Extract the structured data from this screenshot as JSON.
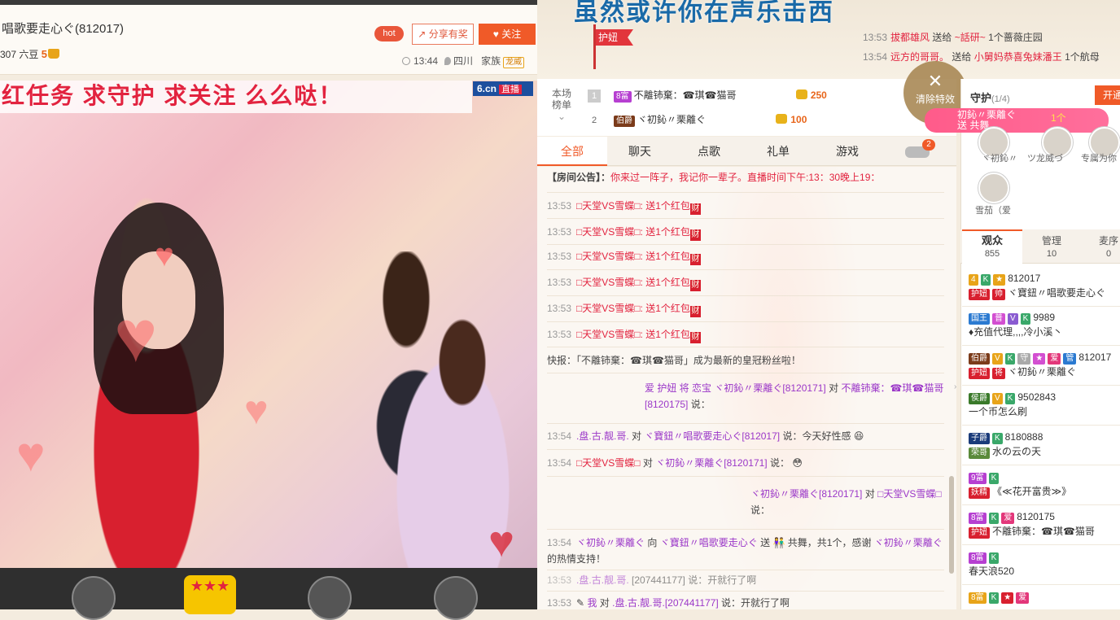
{
  "header": {
    "title": "唱歌要走心ぐ(812017)",
    "sub_prefix": "307 六豆",
    "level": "5",
    "hot": "hot",
    "share": "分享有奖",
    "follow": "关注",
    "time": "13:44",
    "location": "四川",
    "family_label": "家族",
    "family_badge": "龙威"
  },
  "video": {
    "banner": "红任务   求守护   求关注   么么哒！",
    "logo": "6.cn",
    "live": "直播",
    "gift_icon": "★★★"
  },
  "top_area": {
    "big_text": "虽然或许你在声乐击西",
    "guard_flag": "护妞",
    "messages": [
      {
        "time": "13:53",
        "from": "拔都雄风",
        "verb": "送给",
        "to": "~話研~",
        "gift": "1个蔷薇庄园"
      },
      {
        "time": "13:54",
        "from": "远方的哥哥。",
        "verb": "送给",
        "to": "小舅妈恭喜兔妹潘王",
        "gift": "1个航母"
      }
    ]
  },
  "ranking": {
    "label_line1": "本场",
    "label_line2": "榜单",
    "rows": [
      {
        "rank": "1",
        "badge": "8富",
        "name": "不離铈棄：☎琪☎猫哥",
        "score": "250"
      },
      {
        "rank": "2",
        "badge": "伯爵",
        "name": "ヾ初鈊〃栗離ぐ",
        "score": "100"
      }
    ]
  },
  "tabs": [
    "全部",
    "聊天",
    "点歌",
    "礼单",
    "游戏"
  ],
  "cart_count": "2",
  "chat": {
    "notice_label": "【房间公告】：",
    "notice": "你来过一阵子，我记你一辈子。直播时间下午:13：30晚上19：",
    "cai": "财",
    "gift_lines": [
      {
        "time": "13:53",
        "text": "□天堂VS雪蝶□: 送1个红包"
      },
      {
        "time": "13:53",
        "text": "□天堂VS雪蝶□: 送1个红包"
      },
      {
        "time": "13:53",
        "text": "□天堂VS雪蝶□: 送1个红包"
      },
      {
        "time": "13:53",
        "text": "□天堂VS雪蝶□: 送1个红包"
      },
      {
        "time": "13:53",
        "text": "□天堂VS雪蝶□: 送1个红包"
      },
      {
        "time": "13:53",
        "text": "□天堂VS雪蝶□: 送1个红包"
      }
    ],
    "flash": "快报：「不離铈棄：☎琪☎猫哥」成为最新的皇冠粉丝啦！",
    "m1_badges": "爱 护妞 将 恋宝",
    "m1_name": "ヾ初鈊〃栗離ぐ[8120171]",
    "m1_to": "对",
    "m1_target": "不離铈棄：☎琪☎猫哥[8120175]",
    "m1_say": "说：",
    "m2_time": "13:54",
    "m2_from": ".盘.古.靓.哥.",
    "m2_to": "对",
    "m2_target": "ヾ寶鈕〃唱歌要走心ぐ[812017]",
    "m2_say": "说：今天好性感",
    "m3_time": "13:54",
    "m3_from": "□天堂VS雪蝶□",
    "m3_to": "对",
    "m3_target": "ヾ初鈊〃栗離ぐ[8120171]",
    "m3_say": "说：",
    "m4_name": "ヾ初鈊〃栗離ぐ[8120171]",
    "m4_to": "对",
    "m4_target": "□天堂VS雪蝶□",
    "m4_say": "说：",
    "m5_time": "13:54",
    "m5_from": "ヾ初鈊〃栗離ぐ",
    "m5_dir": "向",
    "m5_target": "ヾ寶鈕〃唱歌要走心ぐ",
    "m5_send": "送",
    "m5_gift": "共舞，共1个，感谢",
    "m5_thanks": "ヾ初鈊〃栗離ぐ",
    "m5_end": "的热情支持！",
    "m6_time": "13:53",
    "m6_from": ".盘.古.靓.哥.",
    "m6_mid": "[207441177]",
    "m6_say": "说：开就行了啊",
    "m7_time": "13:53",
    "m7_me": "我",
    "m7_to": "对",
    "m7_target": ".盘.古.靓.哥.[207441177]",
    "m7_say": "说：开就行了啊"
  },
  "clear_effect": "清除特效",
  "right": {
    "guard_title": "守护",
    "guard_count": "(1/4)",
    "open_btn": "开通",
    "gift_tip_name": "初鈊〃栗離ぐ",
    "gift_tip_count": "1个",
    "gift_tip_action": "送 共舞",
    "guards": [
      "ヾ初鈊〃",
      "ツ龙威づ",
      "专属为你",
      "雪茄（爱"
    ],
    "view_tabs": [
      {
        "label": "观众",
        "count": "855"
      },
      {
        "label": "管理",
        "count": "10"
      },
      {
        "label": "麦序",
        "count": "0"
      }
    ],
    "users": [
      {
        "badge": "4",
        "id": "812017",
        "role": "护妞",
        "role2": "帅",
        "name": "ヾ寶鈕〃唱歌要走心ぐ"
      },
      {
        "badge": "国王",
        "id": "9989",
        "name": "♦充值代理,,,,冷小溪丶"
      },
      {
        "badge": "伯爵",
        "id": "812017",
        "role": "护妞",
        "role2": "将",
        "name": "ヾ初鈊〃栗離ぐ"
      },
      {
        "badge": "侯爵",
        "id": "9502843",
        "name": "一个币怎么刷"
      },
      {
        "badge": "子爵",
        "id": "8180888",
        "role": "荣哥",
        "name": "水の云の天"
      },
      {
        "badge": "9富",
        "id": "",
        "role": "妖精",
        "name": "《≪花开富贵≫》"
      },
      {
        "badge": "8富",
        "id": "8120175",
        "role": "护妞",
        "name": "不離铈棄：☎琪☎猫哥"
      },
      {
        "badge": "8富",
        "id": "",
        "name": "春天浪520"
      },
      {
        "badge": "8富",
        "id": "",
        "name": ""
      }
    ]
  },
  "colors": {
    "accent": "#f05a28",
    "red": "#e2233f",
    "purple": "#9b37c8"
  }
}
